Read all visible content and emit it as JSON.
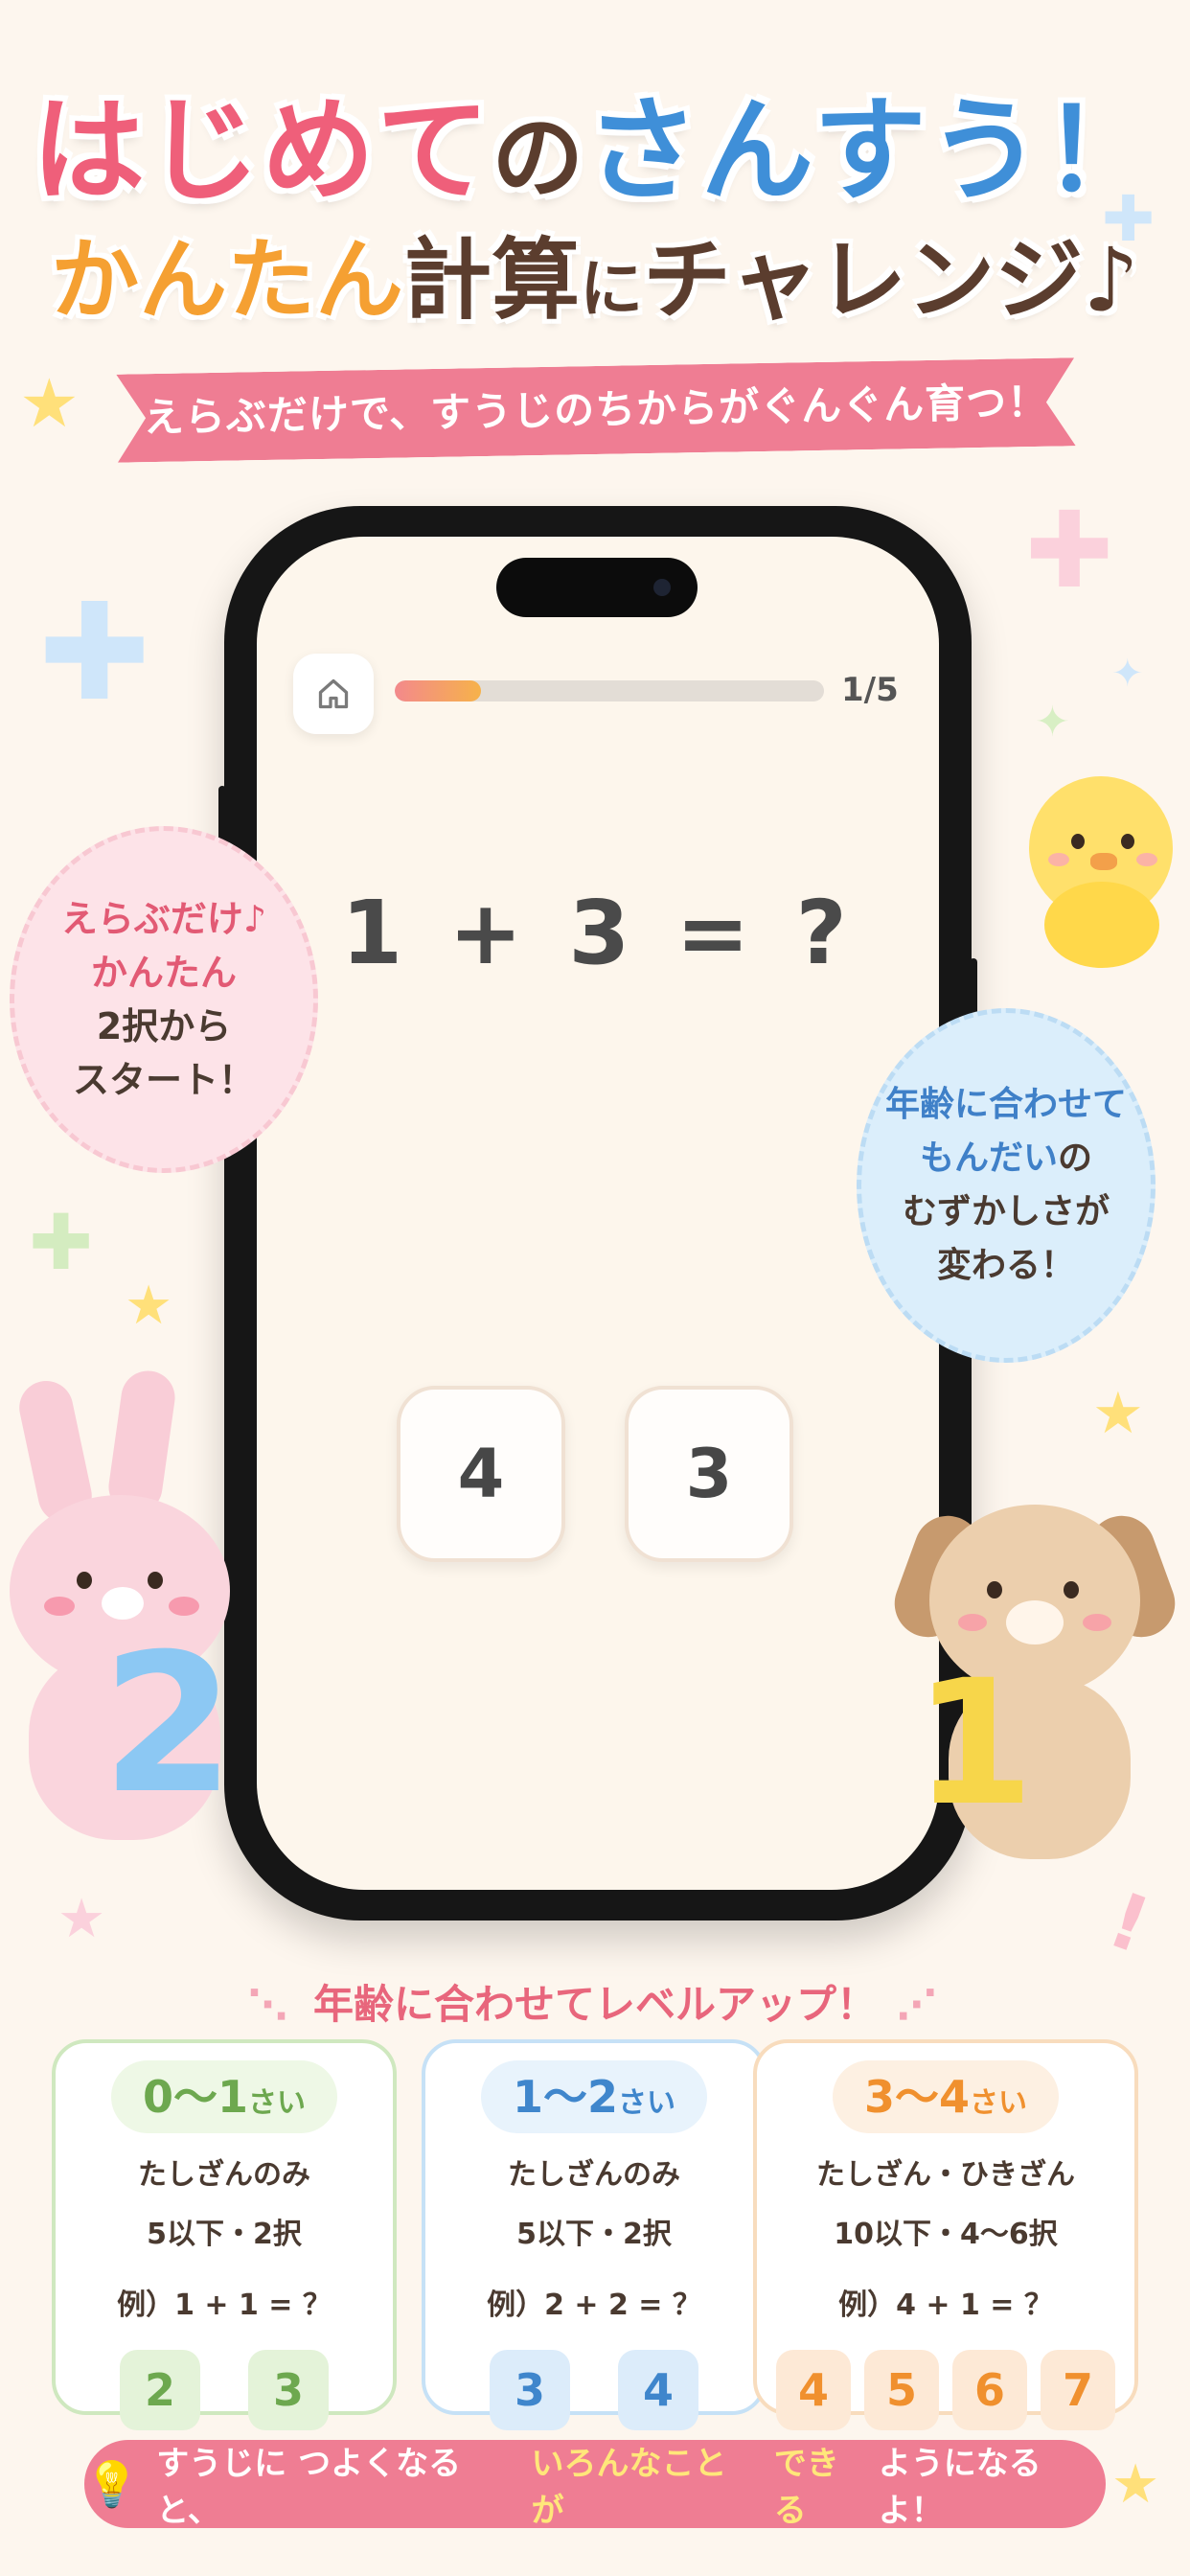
{
  "headline": {
    "part1": "はじめて",
    "part2": "の",
    "part3": "さんすう！",
    "line2_a": "かんたん",
    "line2_b": "計算",
    "line2_c": "に",
    "line2_d": "チャレンジ♪",
    "ribbon": "えらぶだけで、すうじのちからがぐんぐん育つ！"
  },
  "app": {
    "home_icon": "home-icon",
    "progress_label": "1/5",
    "progress_fraction": 0.2,
    "question": "1 + 3 = ?",
    "answers": [
      "4",
      "3"
    ]
  },
  "bubbles": {
    "pink": [
      "えらぶだけ♪",
      "かんたん",
      "2択から",
      "スタート！"
    ],
    "blue": [
      "年齢に合わせて",
      "もんだい",
      "の",
      "むずかしさが",
      "変わる！"
    ]
  },
  "levels": {
    "title": "年齢に合わせてレベルアップ！",
    "cards": [
      {
        "age": "0〜1",
        "unit": "さい",
        "line1": "たしざんのみ",
        "line2": "5以下・2択",
        "example": "例）1 + 1 = ？",
        "choices": [
          "2",
          "3"
        ],
        "color": "#6da84f"
      },
      {
        "age": "1〜2",
        "unit": "さい",
        "line1": "たしざんのみ",
        "line2": "5以下・2択",
        "example": "例）2 + 2 = ？",
        "choices": [
          "3",
          "4"
        ],
        "color": "#3f86cc"
      },
      {
        "age": "3〜4",
        "unit": "さい",
        "line1": "たしざん・ひきざん",
        "line2": "10以下・4〜6択",
        "example": "例）4 + 1 = ？",
        "choices": [
          "4",
          "5",
          "6",
          "7"
        ],
        "color": "#f0902e"
      }
    ]
  },
  "footer": {
    "a": "すうじに つよくなると、",
    "b": "いろんなことが",
    "c": " ",
    "d": "できる",
    "e": "ようになるよ！",
    "icon": "lightbulb-icon"
  },
  "colors": {
    "pink": "#ef5f7a",
    "blue": "#3f8fd8",
    "orange": "#f5a032",
    "brown": "#5b3d2e"
  }
}
